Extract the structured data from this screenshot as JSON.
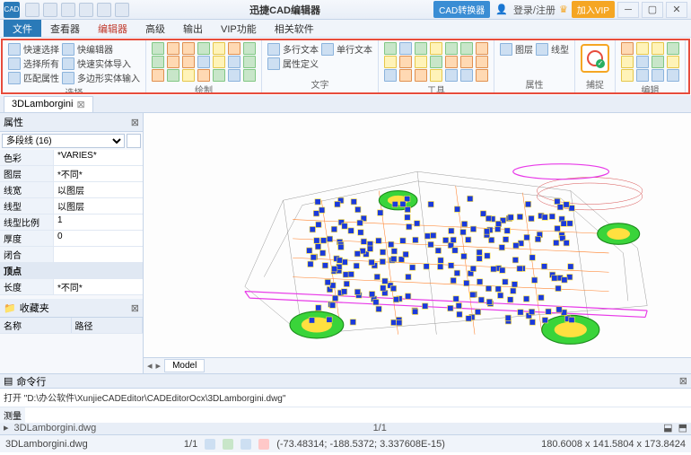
{
  "app": {
    "title": "迅捷CAD编辑器",
    "logo_text": "CAD"
  },
  "titlebar_right": {
    "converter": "CAD转换器",
    "login": "登录/注册",
    "vip": "加入VIP"
  },
  "menu": {
    "tabs": [
      "文件",
      "查看器",
      "编辑器",
      "高级",
      "输出",
      "VIP功能",
      "相关软件"
    ],
    "active_index": 0,
    "red_index": 2
  },
  "ribbon": {
    "groups": [
      {
        "name": "选择",
        "items": [
          "快速选择",
          "快编辑器",
          "选择所有",
          "快速实体导入",
          "匹配属性",
          "多边形实体输入"
        ]
      },
      {
        "name": "绘制",
        "grid": true,
        "cols": 7,
        "rows": 3
      },
      {
        "name": "文字",
        "items": [
          "多行文本",
          "单行文本",
          "属性定义"
        ]
      },
      {
        "name": "工具",
        "grid": true,
        "cols": 7,
        "rows": 3
      },
      {
        "name": "属性",
        "items": [
          "图层",
          "线型"
        ]
      },
      {
        "name": "捕捉",
        "big": true
      },
      {
        "name": "编辑",
        "grid": true,
        "cols": 4,
        "rows": 3
      }
    ]
  },
  "doc_tab": {
    "name": "3DLamborgini"
  },
  "props_panel": {
    "title": "属性",
    "selector": "多段线 (16)",
    "rows": [
      {
        "k": "色彩",
        "v": "*VARIES*"
      },
      {
        "k": "图层",
        "v": "*不同*"
      },
      {
        "k": "线宽",
        "v": "以图层"
      },
      {
        "k": "线型",
        "v": "以图层"
      },
      {
        "k": "线型比例",
        "v": "1"
      },
      {
        "k": "厚度",
        "v": "0"
      },
      {
        "k": "闭合",
        "v": ""
      },
      {
        "k": "顶点",
        "v": "",
        "hdr": true
      },
      {
        "k": "长度",
        "v": "*不同*"
      }
    ]
  },
  "fav_panel": {
    "title": "收藏夹",
    "cols": [
      "名称",
      "路径"
    ]
  },
  "model_tab": "Model",
  "cmd_panel": {
    "title": "命令行",
    "log": "打开 \"D:\\办公软件\\XunjieCADEditor\\CADEditorOcx\\3DLamborgini.dwg\"",
    "prompt": "测量"
  },
  "editor_strip": {
    "file": "3DLamborgini.dwg",
    "pos": "1/1"
  },
  "status": {
    "coords": "(-73.48314; -188.5372; 3.337608E-15)",
    "dims": "180.6008 x 141.5804 x 173.8424"
  }
}
